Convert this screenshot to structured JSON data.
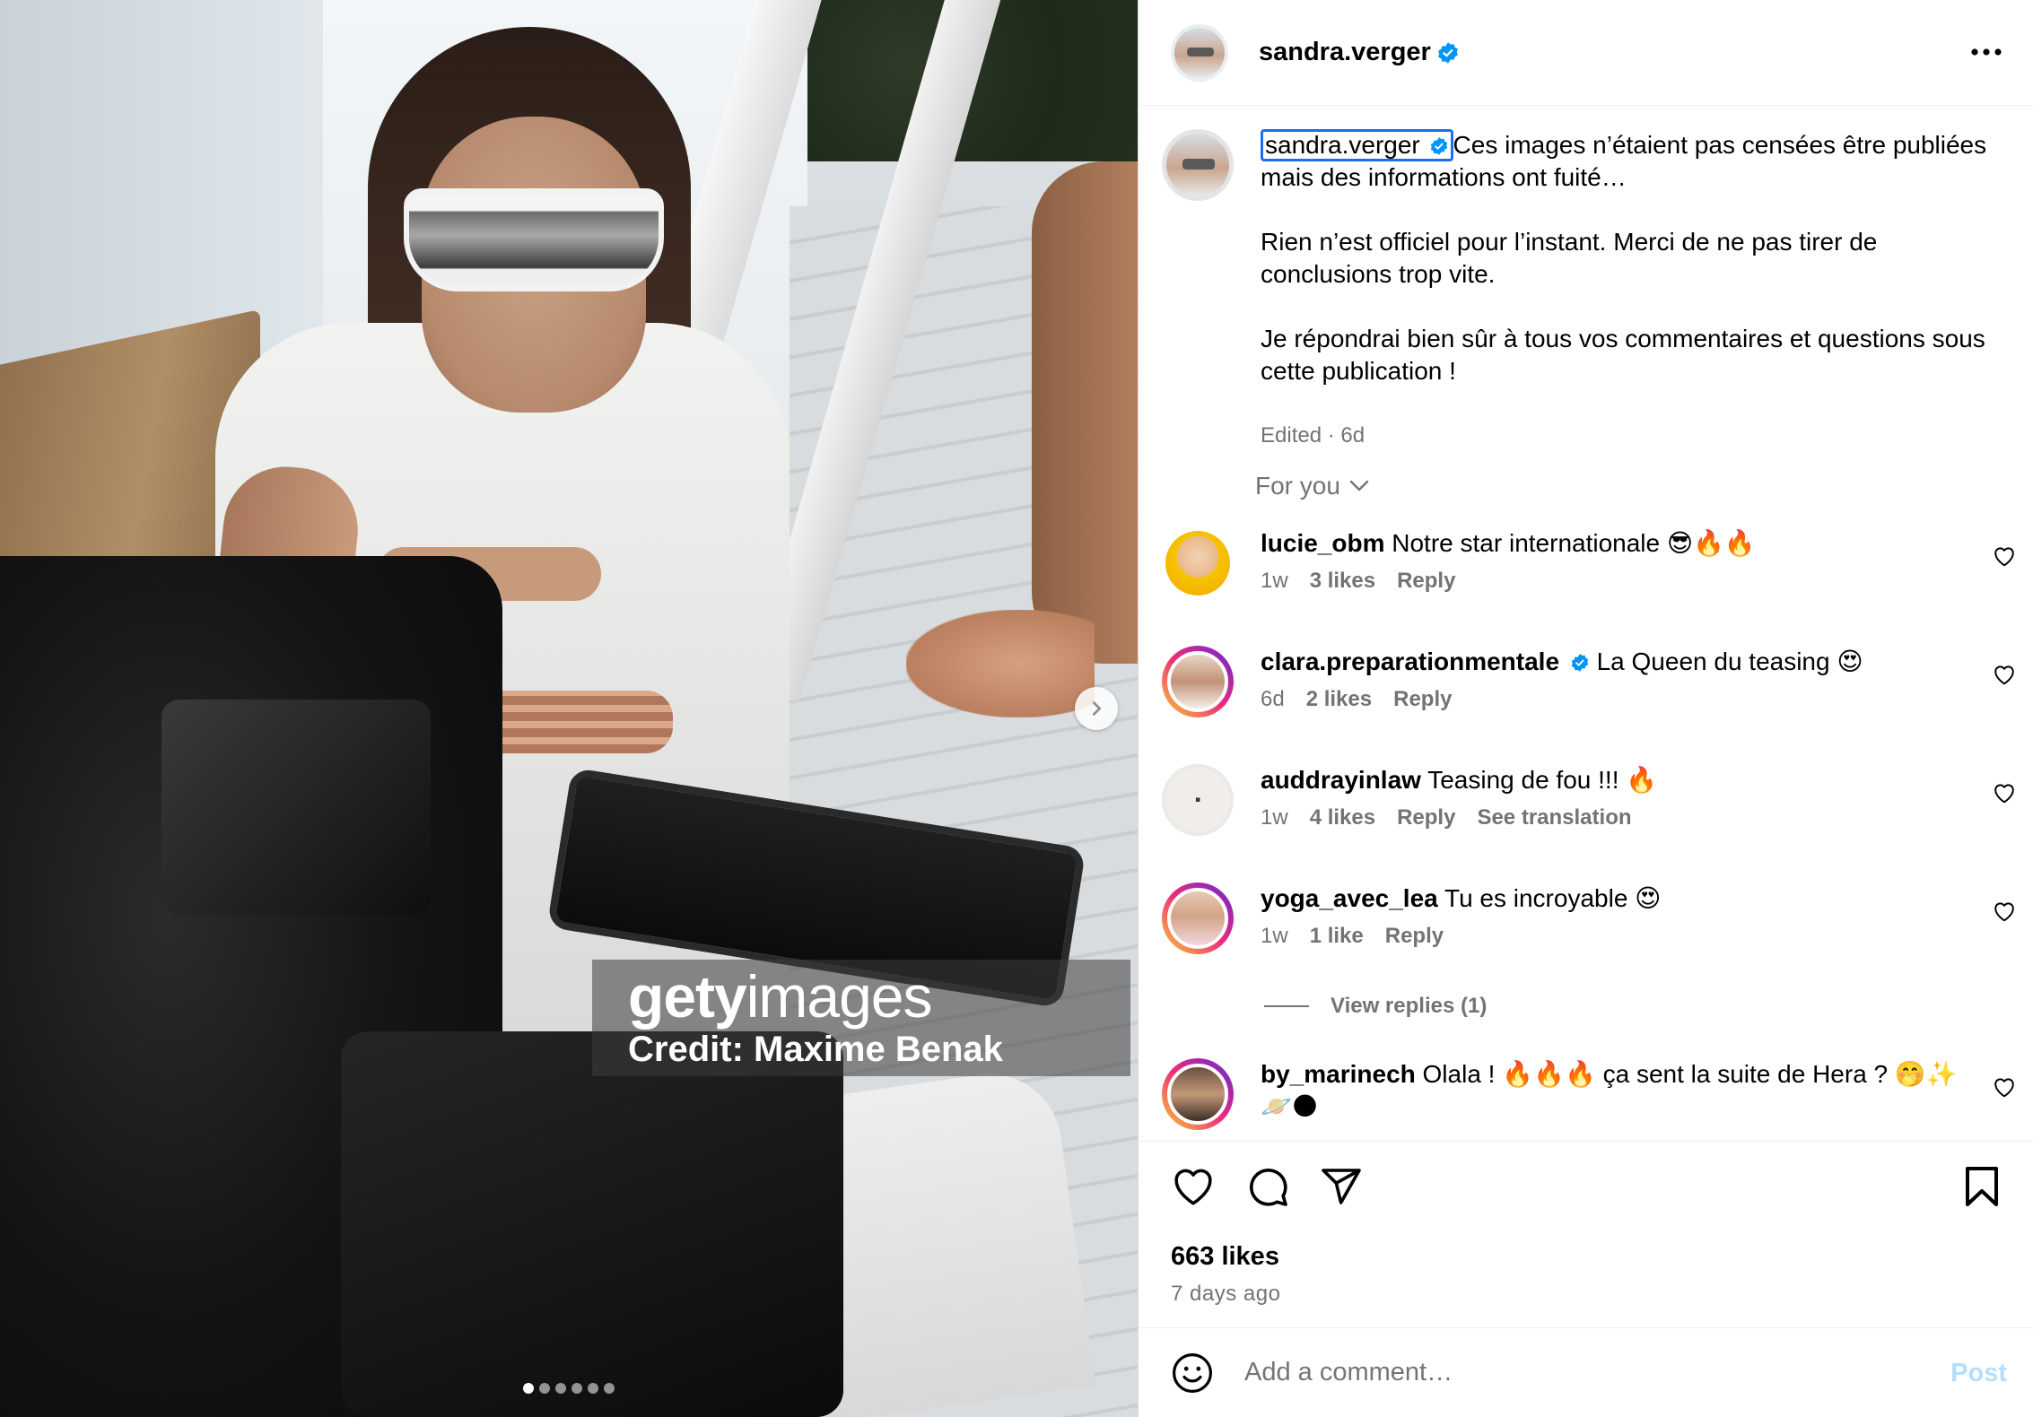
{
  "post": {
    "username": "sandra.verger",
    "caption_paragraphs": [
      "Ces images n’étaient pas censées être publiées mais des informations ont fuité…",
      "Rien n’est officiel pour l’instant. Merci de ne pas tirer de conclusions trop vite.",
      "Je répondrai bien sûr à tous vos commentaires et questions sous cette publication !"
    ],
    "caption_meta": "Edited · 6d",
    "likes": "663 likes",
    "time_ago": "7 days ago"
  },
  "media": {
    "watermark_brand_bold": "gety",
    "watermark_brand_light": "images",
    "watermark_credit": "Credit: Maxime Benak",
    "carousel_count": 6,
    "carousel_active": 1
  },
  "comments_filter": "For you",
  "comments": [
    {
      "username": "lucie_obm",
      "text": "Notre star internationale 😎🔥🔥",
      "time": "1w",
      "likes": "3 likes",
      "reply": "Reply",
      "verified": false
    },
    {
      "username": "clara.preparationmentale",
      "text": "La Queen du teasing 😍",
      "time": "6d",
      "likes": "2 likes",
      "reply": "Reply",
      "verified": true
    },
    {
      "username": "auddrayinlaw",
      "text": "Teasing de fou !!! 🔥",
      "time": "1w",
      "likes": "4 likes",
      "reply": "Reply",
      "translate": "See translation",
      "verified": false
    },
    {
      "username": "yoga_avec_lea",
      "text": "Tu es incroyable 😍",
      "time": "1w",
      "likes": "1 like",
      "reply": "Reply",
      "verified": false
    },
    {
      "username": "by_marinech",
      "text": "Olala ! 🔥🔥🔥 ça sent la suite de Hera ? 🤭✨🪐🌑",
      "verified": false
    }
  ],
  "view_replies": "View replies (1)",
  "add_comment": {
    "placeholder": "Add a comment…",
    "post_label": "Post"
  },
  "colors": {
    "verified": "#0095f6",
    "link_blue": "#1c6ef2",
    "muted": "#737373",
    "post_disabled": "#b2dffc"
  },
  "icons": [
    "more-icon",
    "verified-icon",
    "chevron-right-icon",
    "chevron-down-icon",
    "heart-icon",
    "comment-icon",
    "share-icon",
    "bookmark-icon",
    "emoji-icon"
  ]
}
